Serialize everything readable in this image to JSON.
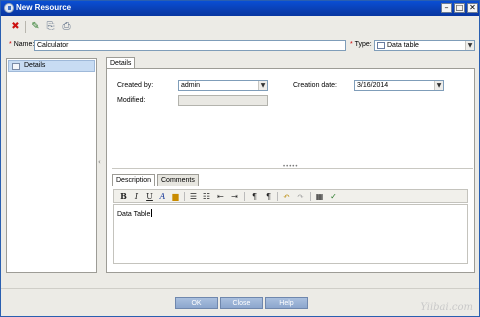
{
  "window": {
    "title": "New Resource",
    "controls": [
      "minimize",
      "maximize",
      "close"
    ]
  },
  "toolbar": {
    "buttons": [
      {
        "icon": "delete-x-icon",
        "glyph": "✖",
        "color": "#cc1111"
      },
      {
        "icon": "add-resource-icon",
        "glyph": "✎",
        "color": "#2a7a2a"
      },
      {
        "icon": "copy-resource-icon",
        "glyph": "⎘",
        "color": "#5a6b84"
      },
      {
        "icon": "paste-resource-icon",
        "glyph": "⎙",
        "color": "#5a6b84"
      }
    ]
  },
  "form": {
    "name_label": "Name",
    "name_value": "Calculator",
    "type_label": "Type",
    "type_value": "Data table"
  },
  "sidebar": {
    "items": [
      {
        "label": "Details"
      }
    ]
  },
  "details": {
    "tab_label": "Details",
    "created_by_label": "Created by:",
    "created_by_value": "admin",
    "creation_date_label": "Creation date:",
    "creation_date_value": "3/16/2014",
    "modified_label": "Modified:",
    "modified_value": ""
  },
  "bottom_tabs": [
    {
      "label": "Description"
    },
    {
      "label": "Comments"
    }
  ],
  "editor": {
    "text": "Data Table",
    "toolbar_icons": [
      "bold-icon",
      "italic-icon",
      "underline-icon",
      "font-color-icon",
      "highlight-icon",
      "bullet-list-icon",
      "numbered-list-icon",
      "outdent-icon",
      "indent-icon",
      "ltr-icon",
      "rtl-icon",
      "undo-icon",
      "redo-icon",
      "insert-table-icon",
      "spell-check-icon"
    ]
  },
  "buttons": {
    "ok": "OK",
    "close": "Close",
    "help": "Help"
  },
  "watermark": "Yiibai.com"
}
